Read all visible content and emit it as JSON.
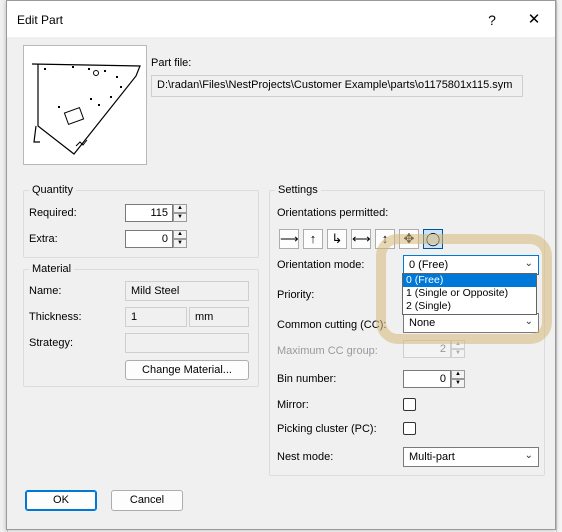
{
  "window": {
    "title": "Edit Part",
    "help": "?",
    "close": "✕"
  },
  "part_file": {
    "label": "Part file:",
    "path": "D:\\radan\\Files\\NestProjects\\Customer Example\\parts\\o1175801x115.sym"
  },
  "quantity": {
    "title": "Quantity",
    "required_label": "Required:",
    "required_value": "115",
    "extra_label": "Extra:",
    "extra_value": "0"
  },
  "material": {
    "title": "Material",
    "name_label": "Name:",
    "name_value": "Mild Steel",
    "thickness_label": "Thickness:",
    "thickness_value": "1",
    "thickness_unit": "mm",
    "strategy_label": "Strategy:",
    "strategy_value": "",
    "change_button": "Change Material..."
  },
  "settings": {
    "title": "Settings",
    "orientations_label": "Orientations permitted:",
    "orientation_icons": [
      "arrow-right-icon",
      "arrow-up-icon",
      "corner-arrows-icon",
      "arrow-left-right-icon",
      "arrow-up-down-icon",
      "move-all-directions-icon",
      "circle-free-icon"
    ],
    "orientation_glyphs": [
      "⟶",
      "↑",
      "↳",
      "⟷",
      "↕",
      "✥",
      "◯"
    ],
    "orientation_mode_label": "Orientation mode:",
    "orientation_mode_value": "0 (Free)",
    "orientation_mode_options": [
      "0 (Free)",
      "1 (Single or Opposite)",
      "2 (Single)"
    ],
    "priority_label": "Priority:",
    "common_cutting_label": "Common cutting (CC):",
    "common_cutting_value": "None",
    "max_cc_group_label": "Maximum CC group:",
    "max_cc_group_value": "2",
    "bin_number_label": "Bin number:",
    "bin_number_value": "0",
    "mirror_label": "Mirror:",
    "picking_cluster_label": "Picking cluster (PC):",
    "nest_mode_label": "Nest mode:",
    "nest_mode_value": "Multi-part"
  },
  "buttons": {
    "ok": "OK",
    "cancel": "Cancel"
  },
  "colors": {
    "highlight": "#0078d7",
    "halo": "#d6b878",
    "dialog_bg": "#f0f0f0"
  }
}
